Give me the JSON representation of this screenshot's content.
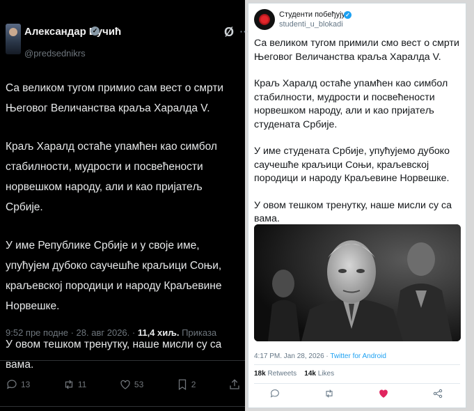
{
  "left_tweet": {
    "author_name": "Александар Вучић",
    "handle": "@predsednikrs",
    "paragraphs": [
      "Са великом тугом примио сам вест о смрти Његовог Величанства краља Харалда V.",
      "Краљ Харалд остаће упамћен као симбол стабилности, мудрости и посвећености норвешком народу, али и као пријатељ Србије.",
      "У име Републике Србије и у своје име, упућујем дубоко саучешће краљици Соњи, краљевској породици и народу Краљевине Норвешке.",
      "У овом тешком тренутку, наше мисли су са вама."
    ],
    "timestamp": "9:52 пре подне · 28. авг 2026. · ",
    "views_count": "11,4 хиљ.",
    "views_label": " Приказа",
    "actions": {
      "replies": "13",
      "retweets": "11",
      "likes": "53",
      "bookmarks": "2"
    }
  },
  "right_tweet": {
    "author_name": "Студенти побеђују",
    "handle": "studenti_u_blokadi",
    "paragraphs": [
      "Са великом тугом примили смо вест о смрти Његовог Величанства краља Харалда V.",
      "Краљ Харалд остаће упамћен као симбол стабилности, мудрости и посвећености норвешком народу, али и као пријатељ студената Србије.",
      "У име студената Србије, упућујемо дубоко саучешће краљици Соњи, краљевској породици и народу Краљевине Норвешке.",
      "У овом тешком тренутку, наше мисли су са вама."
    ],
    "timestamp": "4:17 PM. Jan 28, 2026 · ",
    "source": "Twitter for Android",
    "retweets_count": "18k",
    "retweets_label": " Retweets",
    "likes_count": "14k",
    "likes_label": " Likes"
  },
  "colors": {
    "dark_bg": "#000000",
    "dark_text": "#e7e9ea",
    "dark_muted": "#6e767d",
    "light_text": "#14171a",
    "light_muted": "#657786",
    "link": "#1da1f2",
    "like_active": "#e0245e"
  }
}
